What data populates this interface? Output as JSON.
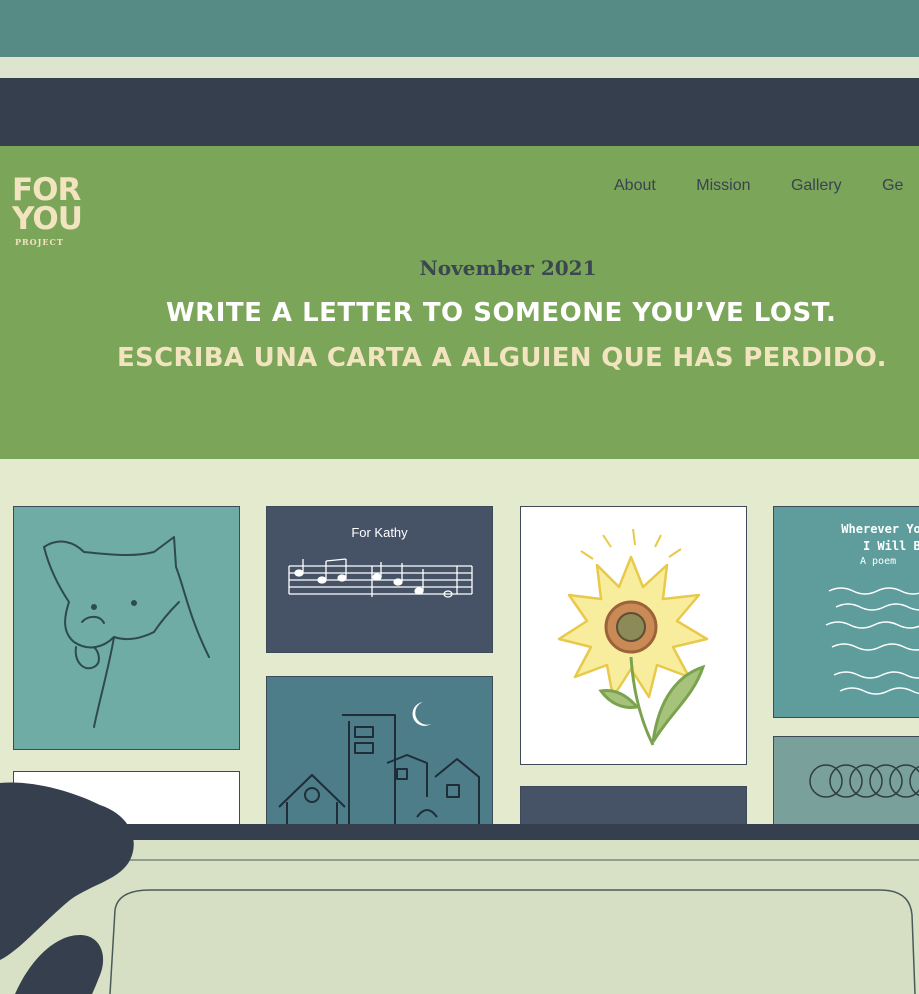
{
  "brand": {
    "line1": "FOR",
    "line2": "YOU",
    "line3": "PROJECT"
  },
  "nav": {
    "items": [
      "About",
      "Mission",
      "Gallery",
      "Ge"
    ]
  },
  "hero": {
    "date": "November 2021",
    "headline_en": "WRITE A LETTER TO SOMEONE YOU’VE LOST.",
    "headline_es": "ESCRIBA UNA CARTA A ALGUIEN QUE HAS PERDIDO."
  },
  "gallery": {
    "kathy_title": "For Kathy",
    "poem_title_line1": "Wherever You",
    "poem_title_line2": "I Will Be",
    "poem_subtitle": "A poem"
  },
  "colors": {
    "topbar": "#568a85",
    "darkbar": "#363f4e",
    "hero": "#7ba559",
    "content_bg": "#e4eace",
    "cream_text": "#f1e4bf",
    "teal_card": "#6faca6",
    "navy_card": "#465266",
    "deep_teal_card": "#4d7d89",
    "poem_card": "#5f9d9d"
  }
}
